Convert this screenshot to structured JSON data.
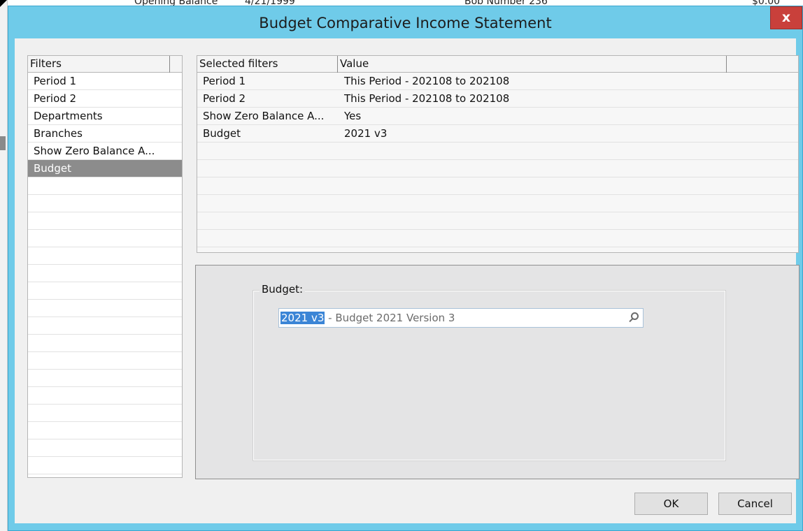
{
  "background": {
    "cells": [
      "Opening Balance",
      "4/21/1999",
      "Bob Number 236",
      "$0.00"
    ]
  },
  "dialog": {
    "title": "Budget Comparative Income Statement",
    "close_label": "x"
  },
  "filters": {
    "header": "Filters",
    "items": [
      {
        "label": "Period 1"
      },
      {
        "label": "Period 2"
      },
      {
        "label": "Departments"
      },
      {
        "label": "Branches"
      },
      {
        "label": "Show Zero Balance A..."
      },
      {
        "label": "Budget"
      }
    ],
    "selected": "Budget"
  },
  "selected_filters": {
    "columns": [
      "Selected filters",
      "Value"
    ],
    "rows": [
      {
        "filter": "Period 1",
        "value": "This Period - 202108 to 202108"
      },
      {
        "filter": "Period 2",
        "value": "This Period - 202108 to 202108"
      },
      {
        "filter": "Show Zero Balance A...",
        "value": "Yes"
      },
      {
        "filter": "Budget",
        "value": "2021 v3"
      }
    ]
  },
  "budget_panel": {
    "group_label": "Budget:",
    "code": "2021 v3",
    "description": " - Budget 2021 Version 3"
  },
  "buttons": {
    "ok": "OK",
    "cancel": "Cancel"
  },
  "colors": {
    "titlebar": "#6fcbe9",
    "close": "#c9403b",
    "selection": "#8c8c8c",
    "highlight": "#3b85d6"
  }
}
